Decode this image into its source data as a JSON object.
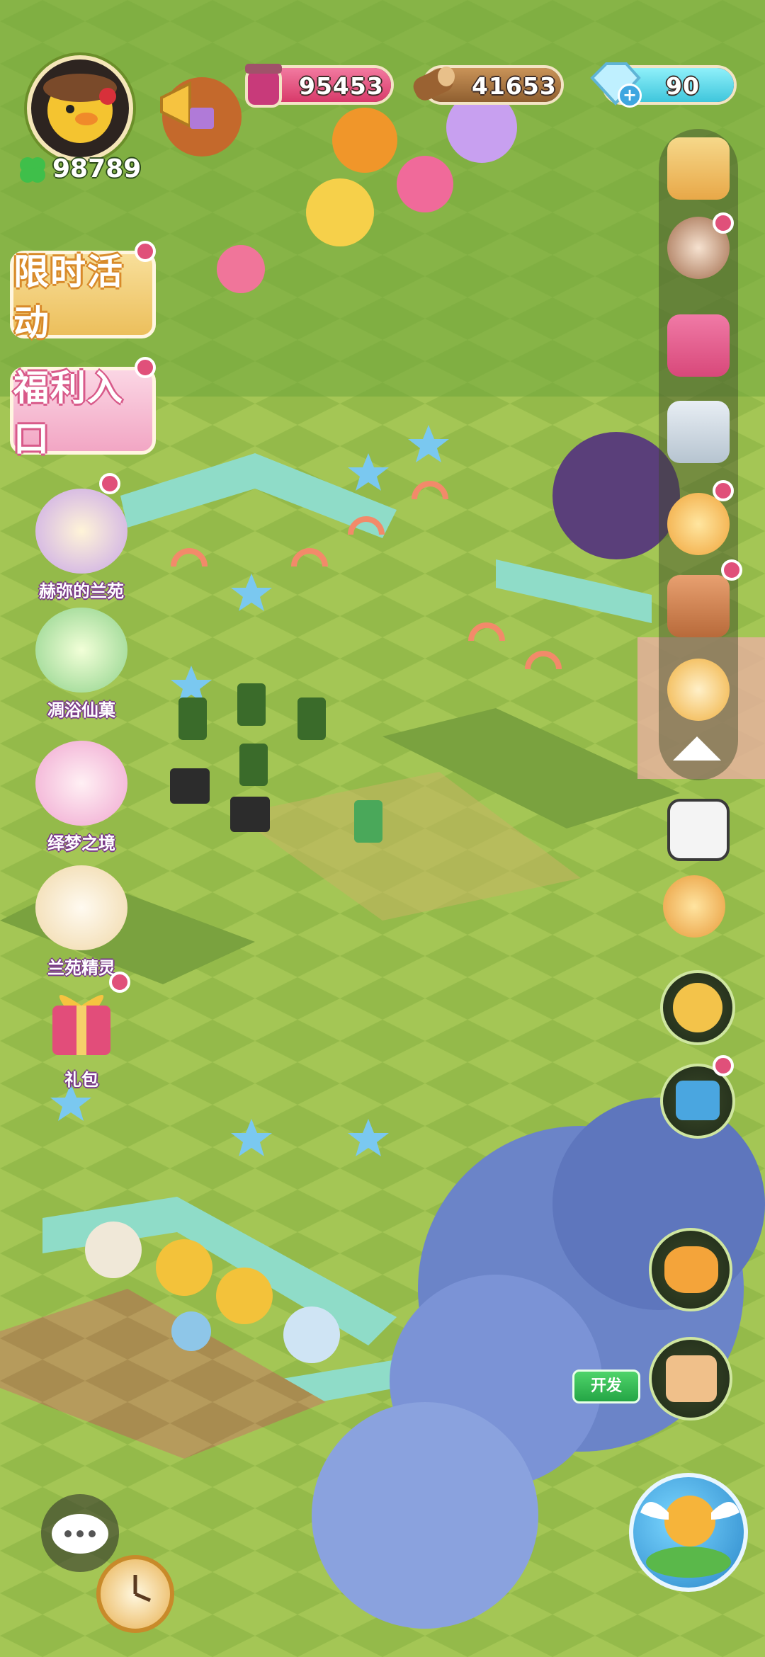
{
  "player": {
    "clover_count": "98789"
  },
  "resources": {
    "jam": "95453",
    "wood": "41653",
    "gems": "90"
  },
  "left_banners": {
    "limited_event": "限时活动",
    "welfare": "福利入口"
  },
  "left_events": [
    {
      "label": "赫弥的兰苑"
    },
    {
      "label": "凋浴仙菓"
    },
    {
      "label": "绎梦之境"
    },
    {
      "label": "兰苑精灵"
    },
    {
      "label": "礼包"
    }
  ],
  "bottom": {
    "dev_button": "开发"
  },
  "colors": {
    "grass_light": "#a9c95a",
    "grass_dark": "#8cb243",
    "water": "#8fdcc8",
    "accent_pink": "#e0507a",
    "resource_pink": "#e84c7c",
    "resource_brown": "#b07a44",
    "resource_cyan": "#6fe0ef"
  }
}
